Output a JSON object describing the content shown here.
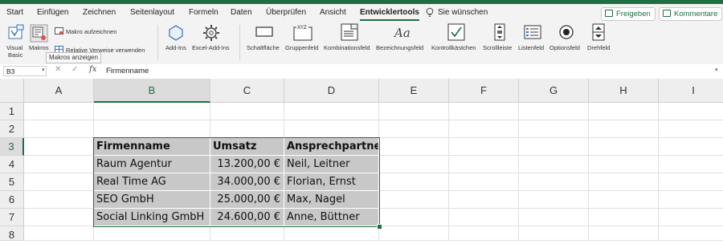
{
  "tabs": {
    "start": "Start",
    "einfuegen": "Einfügen",
    "zeichnen": "Zeichnen",
    "seitenlayout": "Seitenlayout",
    "formeln": "Formeln",
    "daten": "Daten",
    "ueberpruefen": "Überprüfen",
    "ansicht": "Ansicht",
    "entwicklertools": "Entwicklertools",
    "tell_me": "Sie wünschen"
  },
  "header_buttons": {
    "share": "Freigeben",
    "comments": "Kommentare"
  },
  "ribbon": {
    "visual_basic_1": "Visual",
    "visual_basic_2": "Basic",
    "makros": "Makros",
    "makro_aufzeichnen": "Makro aufzeichnen",
    "relative_verweise": "Relative Verweise verwenden",
    "addins": "Add-Ins",
    "excel_addins": "Excel-Add-Ins",
    "schaltflaeche": "Schaltfläche",
    "gruppenfeld": "Gruppenfeld",
    "kombinationsfeld": "Kombinationsfeld",
    "bezeichnungsfeld": "Bezeichnungsfeld",
    "kontrollkaestchen": "Kontrollkästchen",
    "scrollleiste": "Scrollleiste",
    "listenfeld": "Listenfeld",
    "optionsfeld": "Optionsfeld",
    "drehfeld": "Drehfeld",
    "gruppenfeld_icon_text": "XYZ",
    "bezeichnungsfeld_icon_text": "Aa"
  },
  "tooltip": "Makros anzeigen",
  "formula_bar": {
    "name_box": "B3",
    "fx": "fx",
    "content": "Firmenname"
  },
  "columns": [
    "A",
    "B",
    "C",
    "D",
    "E",
    "F",
    "G",
    "H",
    "I"
  ],
  "rows": [
    "1",
    "2",
    "3",
    "4",
    "5",
    "6",
    "7",
    "8"
  ],
  "table": {
    "headers": [
      "Firmenname",
      "Umsatz",
      "Ansprechpartner"
    ],
    "rows": [
      [
        "Raum Agentur",
        "13.200,00 €",
        "Neil, Leitner"
      ],
      [
        "Real Time AG",
        "34.000,00 €",
        "Florian, Ernst"
      ],
      [
        "SEO GmbH",
        "25.000,00 €",
        "Max, Nagel"
      ],
      [
        "Social Linking GmbH",
        "24.600,00 €",
        "Anne, Büttner"
      ]
    ]
  },
  "colors": {
    "accent": "#1e6e42",
    "selection_fill": "#c8c8c8"
  }
}
